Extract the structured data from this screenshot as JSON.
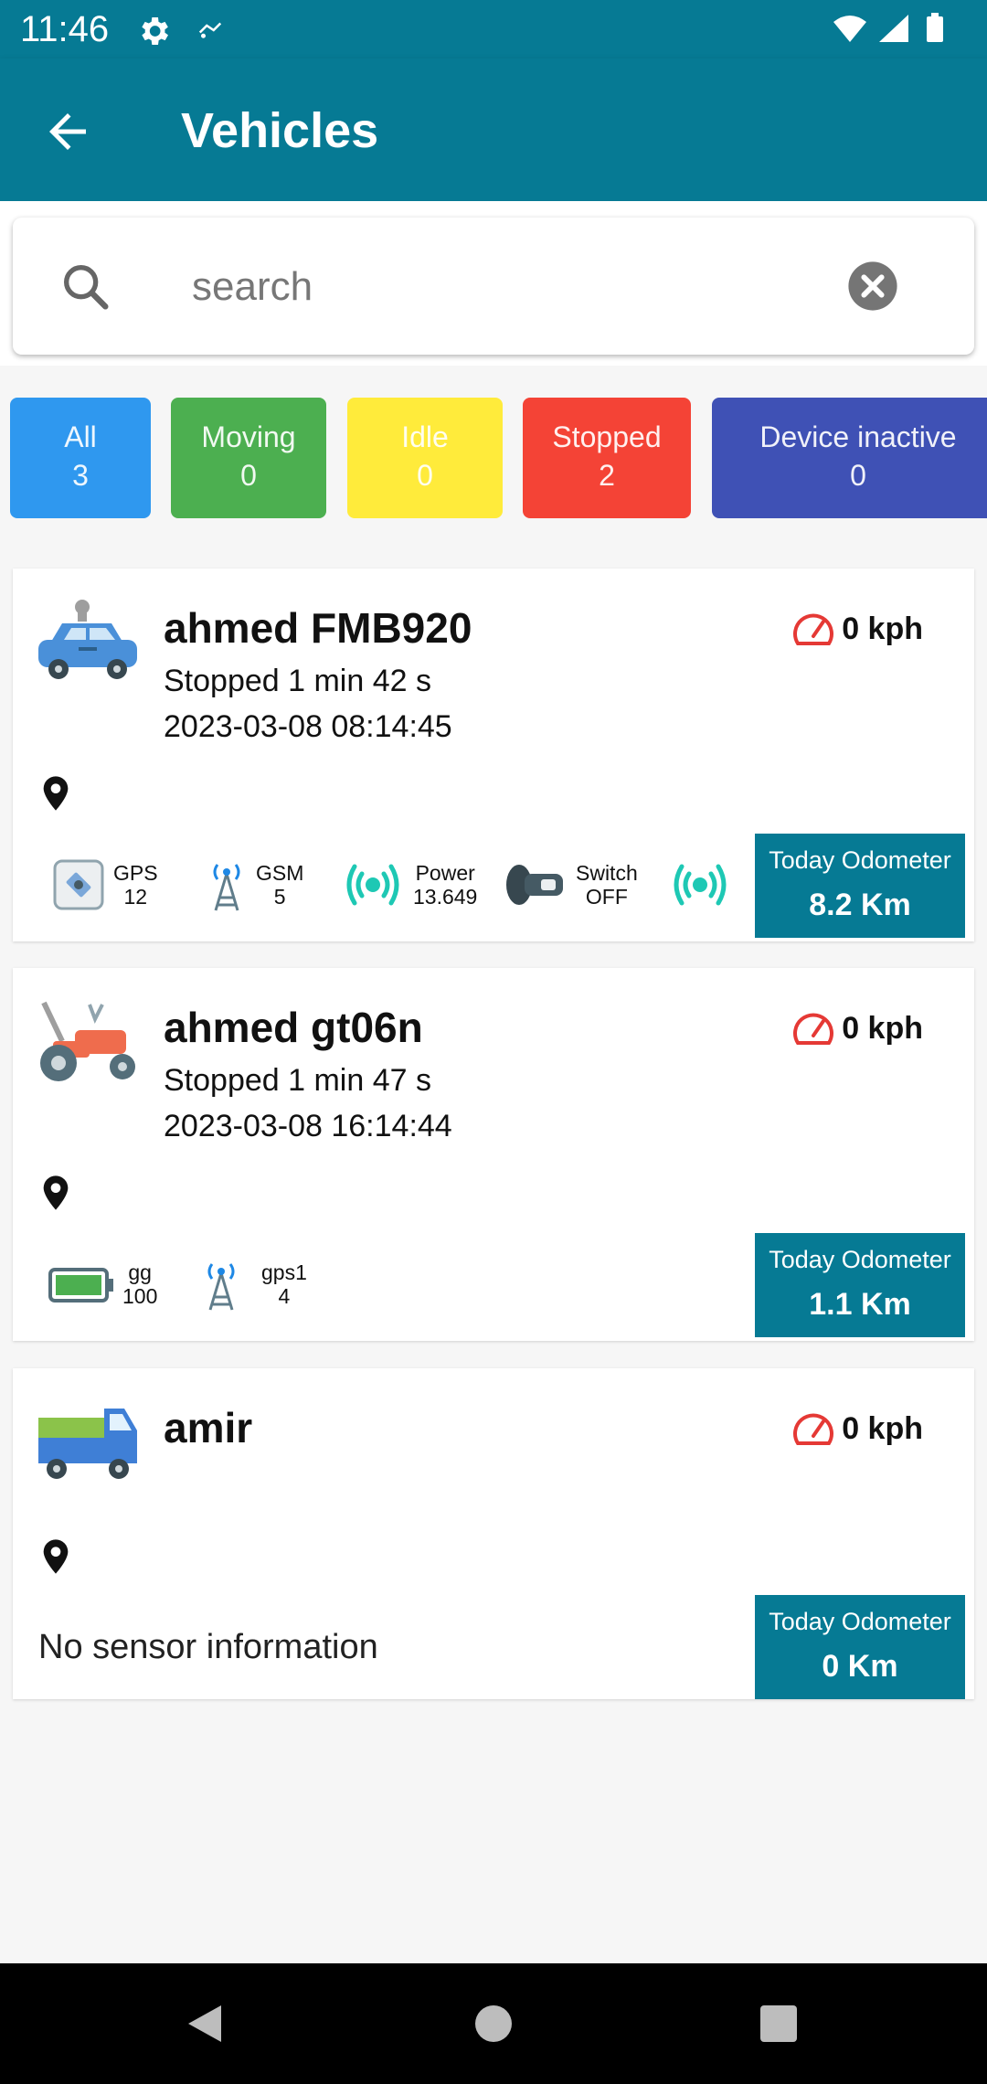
{
  "status_bar": {
    "time": "11:46"
  },
  "header": {
    "title": "Vehicles"
  },
  "search": {
    "placeholder": "search"
  },
  "filters": {
    "all": {
      "label": "All",
      "count": "3"
    },
    "moving": {
      "label": "Moving",
      "count": "0"
    },
    "idle": {
      "label": "Idle",
      "count": "0"
    },
    "stopped": {
      "label": "Stopped",
      "count": "2"
    },
    "inactive": {
      "label": "Device inactive",
      "count": "0"
    }
  },
  "vehicles": [
    {
      "name": "ahmed FMB920",
      "status": "Stopped 1 min 42 s",
      "datetime": "2023-03-08 08:14:45",
      "speed": "0 kph",
      "odometer_label": "Today Odometer",
      "odometer_value": "8.2 Km",
      "icon": "car-icon",
      "sensors": [
        {
          "name": "GPS",
          "value": "12",
          "icon": "satellite-icon"
        },
        {
          "name": "GSM",
          "value": "5",
          "icon": "antenna-tower-icon"
        },
        {
          "name": "Power",
          "value": "13.649",
          "icon": "signal-broadcast-icon"
        },
        {
          "name": "Switch",
          "value": "OFF",
          "icon": "ignition-switch-icon"
        }
      ]
    },
    {
      "name": "ahmed gt06n",
      "status": "Stopped 1 min 47 s",
      "datetime": "2023-03-08 16:14:44",
      "speed": "0 kph",
      "odometer_label": "Today Odometer",
      "odometer_value": "1.1 Km",
      "icon": "tractor-icon",
      "sensors": [
        {
          "name": "gg",
          "value": "100",
          "icon": "battery-icon"
        },
        {
          "name": "gps1",
          "value": "4",
          "icon": "antenna-tower-icon"
        }
      ]
    },
    {
      "name": "amir",
      "speed": "0 kph",
      "odometer_label": "Today Odometer",
      "odometer_value": "0 Km",
      "icon": "truck-icon",
      "no_sensor_text": "No sensor information"
    }
  ],
  "colors": {
    "primary": "#067a94",
    "all": "#2f98ef",
    "moving": "#4caf50",
    "idle": "#ffeb3b",
    "stopped": "#f44336",
    "inactive": "#3f51b5",
    "speed_icon": "#e53935",
    "signal_teal": "#1ec8b4"
  }
}
